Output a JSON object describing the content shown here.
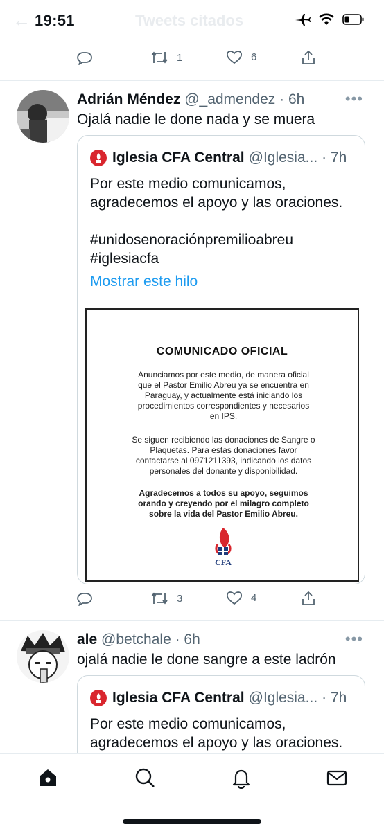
{
  "status_bar": {
    "time": "19:51"
  },
  "header": {
    "title": "Tweets citados"
  },
  "top_actions": {
    "retweets": "1",
    "likes": "6"
  },
  "tweets": [
    {
      "name": "Adrián Méndez",
      "handle": "@_admendez",
      "time": "· 6h",
      "text": "Ojalá nadie le done nada y se muera",
      "actions": {
        "retweets": "3",
        "likes": "4"
      },
      "quote": {
        "name": "Iglesia CFA Central",
        "handle": "@Iglesia...",
        "time": "· 7h",
        "lines": [
          "Por este medio comunicamos,",
          "agradecemos el apoyo y las oraciones.",
          "",
          "#unidosenoraciónpremilioabreu",
          "#iglesiacfa"
        ],
        "show_thread": "Mostrar este hilo",
        "image": {
          "title": "COMUNICADO OFICIAL",
          "para1": [
            "Anunciamos por este medio, de manera oficial",
            "que el Pastor Emilio Abreu ya se encuentra en",
            "Paraguay, y actualmente está iniciando los",
            "procedimientos correspondientes y necesarios",
            "en IPS."
          ],
          "para2": [
            "Se siguen recibiendo las donaciones de Sangre o",
            "Plaquetas. Para estas donaciones favor",
            "contactarse al 0971211393, indicando los datos",
            "personales del donante y disponibilidad."
          ],
          "para3": [
            "Agradecemos a todos su apoyo, seguimos",
            "orando y creyendo por el milagro completo",
            "sobre la vida del Pastor Emilio Abreu."
          ],
          "logo_text": "CFA"
        }
      }
    },
    {
      "name": "ale",
      "handle": "@betchale",
      "time": "· 6h",
      "text": "ojalá nadie le done sangre a este ladrón",
      "quote": {
        "name": "Iglesia CFA Central",
        "handle": "@Iglesia...",
        "time": "· 7h",
        "lines": [
          "Por este medio comunicamos,",
          "agradecemos el apoyo y las oraciones."
        ]
      }
    }
  ],
  "colors": {
    "accent": "#1d9bf0",
    "brand_red": "#d9262e",
    "brand_blue": "#1f3b7a",
    "muted": "#536471"
  },
  "icons": [
    "reply-icon",
    "retweet-icon",
    "like-icon",
    "share-icon",
    "more-icon",
    "home-icon",
    "search-icon",
    "notifications-icon",
    "messages-icon",
    "airplane-icon",
    "wifi-icon",
    "battery-icon"
  ]
}
